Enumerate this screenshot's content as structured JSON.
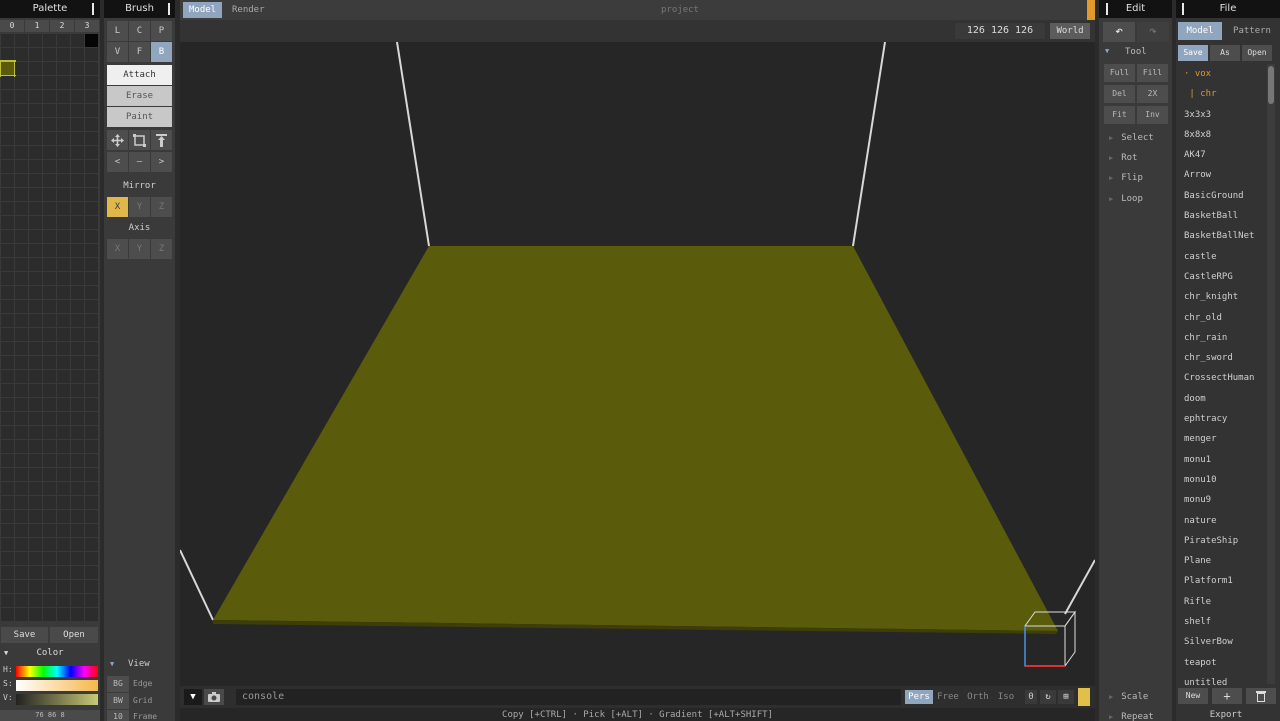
{
  "palette": {
    "title": "Palette",
    "tabs": [
      "0",
      "1",
      "2",
      "3"
    ],
    "save_label": "Save",
    "open_label": "Open",
    "color_header": "Color",
    "h_label": "H:",
    "s_label": "S:",
    "v_label": "V:",
    "hsv_values": "76  86  8",
    "selected_color": "#5b5b0c"
  },
  "brush": {
    "title": "Brush",
    "row1": [
      "L",
      "C",
      "P"
    ],
    "row2": [
      "V",
      "F",
      "B"
    ],
    "attach": "Attach",
    "erase": "Erase",
    "paint": "Paint",
    "tools_row1_icons": [
      "move-icon",
      "select-box-icon",
      "extrude-icon"
    ],
    "tools_row2": [
      "<",
      "–",
      ">"
    ],
    "mirror_label": "Mirror",
    "mirror": [
      "X",
      "Y",
      "Z"
    ],
    "axis_label": "Axis",
    "axis": [
      "X",
      "Y",
      "Z"
    ],
    "view_label": "View",
    "view_rows": [
      {
        "key": "BG",
        "value": "Edge"
      },
      {
        "key": "BW",
        "value": "Grid"
      },
      {
        "key": "10",
        "value": "Frame"
      }
    ]
  },
  "viewport": {
    "tab_model": "Model",
    "tab_render": "Render",
    "project_name": "project",
    "dimensions": "126 126 126",
    "world_label": "World",
    "console_placeholder": "console",
    "camera_modes": [
      "Pers",
      "Free",
      "Orth",
      "Iso"
    ],
    "zoom": "0",
    "status": "Copy [+CTRL] · Pick [+ALT] · Gradient [+ALT+SHIFT]",
    "ground_color": "#5b5b0c"
  },
  "edit": {
    "title": "Edit",
    "tool_label": "Tool",
    "buttons": [
      "Full",
      "Fill",
      "Del",
      "2X",
      "Fit",
      "Inv"
    ],
    "tree": [
      "Select",
      "Rot",
      "Flip",
      "Loop"
    ],
    "bottom": [
      "Scale",
      "Repeat"
    ]
  },
  "file": {
    "title": "File",
    "tab_model": "Model",
    "tab_pattern": "Pattern",
    "save_label": "Save",
    "as_label": "As",
    "open_label": "Open",
    "folders": [
      "vox",
      "chr"
    ],
    "items": [
      "3x3x3",
      "8x8x8",
      "AK47",
      "Arrow",
      "BasicGround",
      "BasketBall",
      "BasketBallNet",
      "castle",
      "CastleRPG",
      "chr_knight",
      "chr_old",
      "chr_rain",
      "chr_sword",
      "CrossectHuman",
      "doom",
      "ephtracy",
      "menger",
      "monu1",
      "monu10",
      "monu9",
      "nature",
      "PirateShip",
      "Plane",
      "Platform1",
      "Rifle",
      "shelf",
      "SilverBow",
      "teapot",
      "untitled"
    ],
    "new_label": "New",
    "plus_label": "+",
    "export_label": "Export"
  },
  "colors": {
    "accent": "#8fa6be",
    "highlight": "#e0b84a",
    "orange": "#e09a2a"
  }
}
